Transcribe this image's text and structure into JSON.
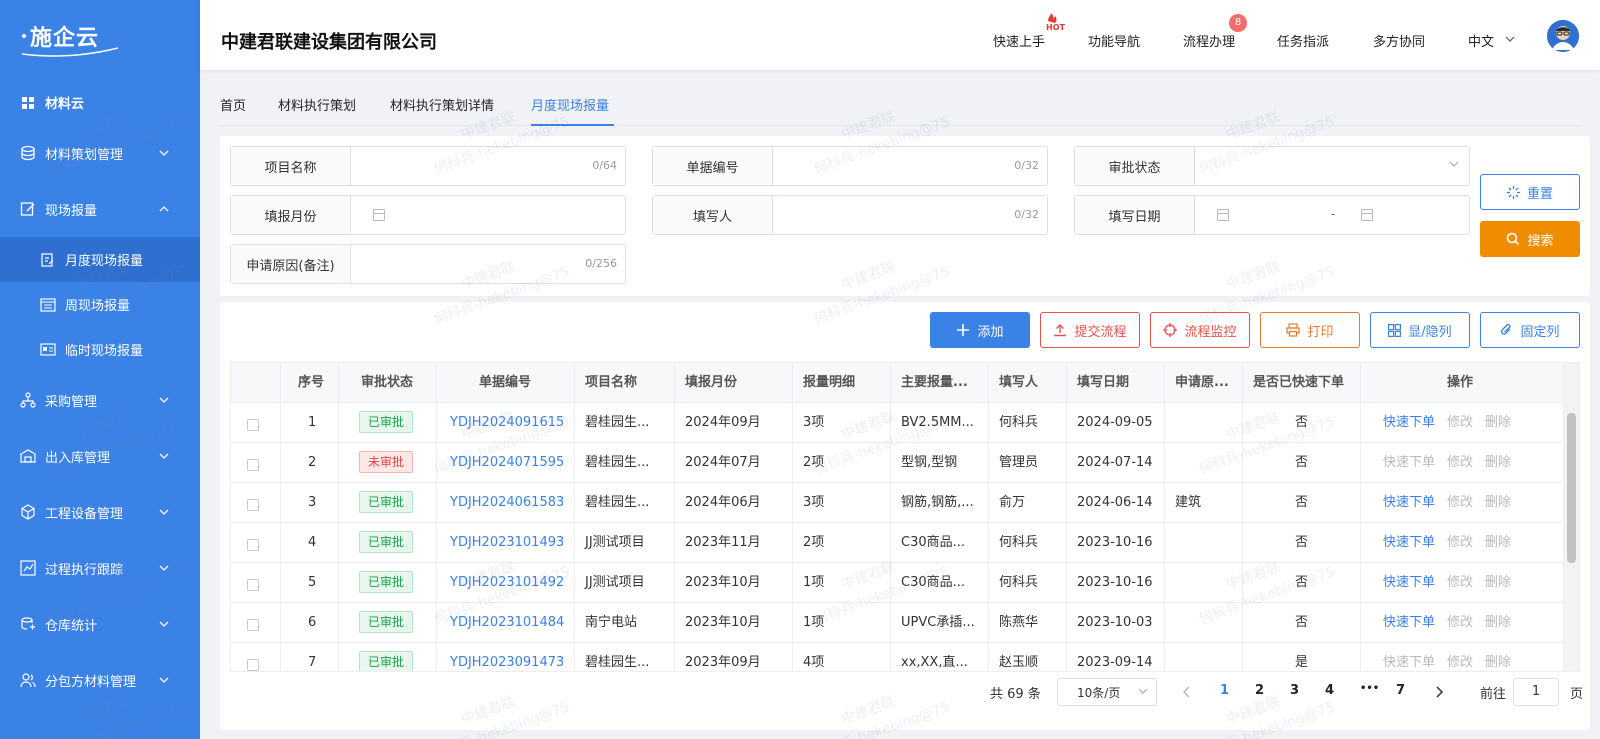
{
  "brand": {
    "logo_text": "施企云"
  },
  "sidebar": {
    "top_item": "材料云",
    "items": [
      {
        "label": "材料策划管理",
        "icon": "database-icon"
      },
      {
        "label": "现场报量",
        "icon": "edit-icon",
        "expanded": true,
        "children": [
          {
            "label": "月度现场报量",
            "active": true
          },
          {
            "label": "周现场报量"
          },
          {
            "label": "临时现场报量"
          }
        ]
      },
      {
        "label": "采购管理",
        "icon": "network-icon"
      },
      {
        "label": "出入库管理",
        "icon": "warehouse-icon"
      },
      {
        "label": "工程设备管理",
        "icon": "cube-icon"
      },
      {
        "label": "过程执行跟踪",
        "icon": "track-icon"
      },
      {
        "label": "仓库统计",
        "icon": "stats-icon"
      },
      {
        "label": "分包方材料管理",
        "icon": "people-icon"
      }
    ]
  },
  "header": {
    "company": "中建君联建设集团有限公司",
    "nav": [
      "快速上手",
      "功能导航",
      "流程办理",
      "任务指派",
      "多方协同"
    ],
    "hot_label": "HOT",
    "badge_count": "8",
    "language": "中文"
  },
  "tabs": [
    "首页",
    "材料执行策划",
    "材料执行策划详情",
    "月度现场报量"
  ],
  "filters": {
    "project_name": {
      "label": "项目名称",
      "counter": "0/64"
    },
    "doc_no": {
      "label": "单据编号",
      "counter": "0/32"
    },
    "approval_status": {
      "label": "审批状态"
    },
    "report_month": {
      "label": "填报月份"
    },
    "filler": {
      "label": "填写人",
      "counter": "0/32"
    },
    "fill_date": {
      "label": "填写日期",
      "separator": "-"
    },
    "reason": {
      "label": "申请原因(备注)",
      "counter": "0/256"
    },
    "reset_label": "重置",
    "search_label": "搜索"
  },
  "toolbar": {
    "add": "添加",
    "submit": "提交流程",
    "monitor": "流程监控",
    "print": "打印",
    "toggle_cols": "显/隐列",
    "pin_cols": "固定列"
  },
  "table": {
    "headers": [
      "序号",
      "审批状态",
      "单据编号",
      "项目名称",
      "填报月份",
      "报量明细",
      "主要报量...",
      "填写人",
      "填写日期",
      "申请原...",
      "是否已快速下单",
      "操作"
    ],
    "rows": [
      {
        "no": "1",
        "status": "已审批",
        "approved": true,
        "doc": "YDJH2024091615",
        "project": "碧桂园生...",
        "month": "2024年09月",
        "detail": "3项",
        "main": "BV2.5MM...",
        "filler": "何科兵",
        "date": "2024-09-05",
        "reason": "",
        "ordered": "否",
        "quick_enabled": true
      },
      {
        "no": "2",
        "status": "未审批",
        "approved": false,
        "doc": "YDJH2024071595",
        "project": "碧桂园生...",
        "month": "2024年07月",
        "detail": "2项",
        "main": "型钢,型钢",
        "filler": "管理员",
        "date": "2024-07-14",
        "reason": "",
        "ordered": "否",
        "quick_enabled": false
      },
      {
        "no": "3",
        "status": "已审批",
        "approved": true,
        "doc": "YDJH2024061583",
        "project": "碧桂园生...",
        "month": "2024年06月",
        "detail": "3项",
        "main": "钢筋,钢筋,...",
        "filler": "俞万",
        "date": "2024-06-14",
        "reason": "建筑",
        "ordered": "否",
        "quick_enabled": true
      },
      {
        "no": "4",
        "status": "已审批",
        "approved": true,
        "doc": "YDJH2023101493",
        "project": "JJ测试项目",
        "month": "2023年11月",
        "detail": "2项",
        "main": "C30商品...",
        "filler": "何科兵",
        "date": "2023-10-16",
        "reason": "",
        "ordered": "否",
        "quick_enabled": true
      },
      {
        "no": "5",
        "status": "已审批",
        "approved": true,
        "doc": "YDJH2023101492",
        "project": "JJ测试项目",
        "month": "2023年10月",
        "detail": "1项",
        "main": "C30商品...",
        "filler": "何科兵",
        "date": "2023-10-16",
        "reason": "",
        "ordered": "否",
        "quick_enabled": true
      },
      {
        "no": "6",
        "status": "已审批",
        "approved": true,
        "doc": "YDJH2023101484",
        "project": "南宁电站",
        "month": "2023年10月",
        "detail": "1项",
        "main": "UPVC承插...",
        "filler": "陈燕华",
        "date": "2023-10-03",
        "reason": "",
        "ordered": "否",
        "quick_enabled": true
      },
      {
        "no": "7",
        "status": "已审批",
        "approved": true,
        "doc": "YDJH2023091473",
        "project": "碧桂园生...",
        "month": "2023年09月",
        "detail": "4项",
        "main": "xx,XX,直...",
        "filler": "赵玉顺",
        "date": "2023-09-14",
        "reason": "",
        "ordered": "是",
        "quick_enabled": false
      }
    ],
    "actions": {
      "quick": "快速下单",
      "edit": "修改",
      "delete": "删除"
    }
  },
  "pagination": {
    "total": "共 69 条",
    "page_size": "10条/页",
    "pages": [
      "1",
      "2",
      "3",
      "4",
      "•••",
      "7"
    ],
    "current": "1",
    "goto_prefix": "前往",
    "goto_value": "1",
    "goto_suffix": "页"
  },
  "watermark": [
    "中建君联",
    "何科兵-hekebing@75"
  ],
  "colors": {
    "primary": "#3b82e6",
    "search": "#f08c00",
    "danger": "#e6534f",
    "print": "#e6792e",
    "approved": "#16a34a",
    "unapproved": "#e04848"
  }
}
